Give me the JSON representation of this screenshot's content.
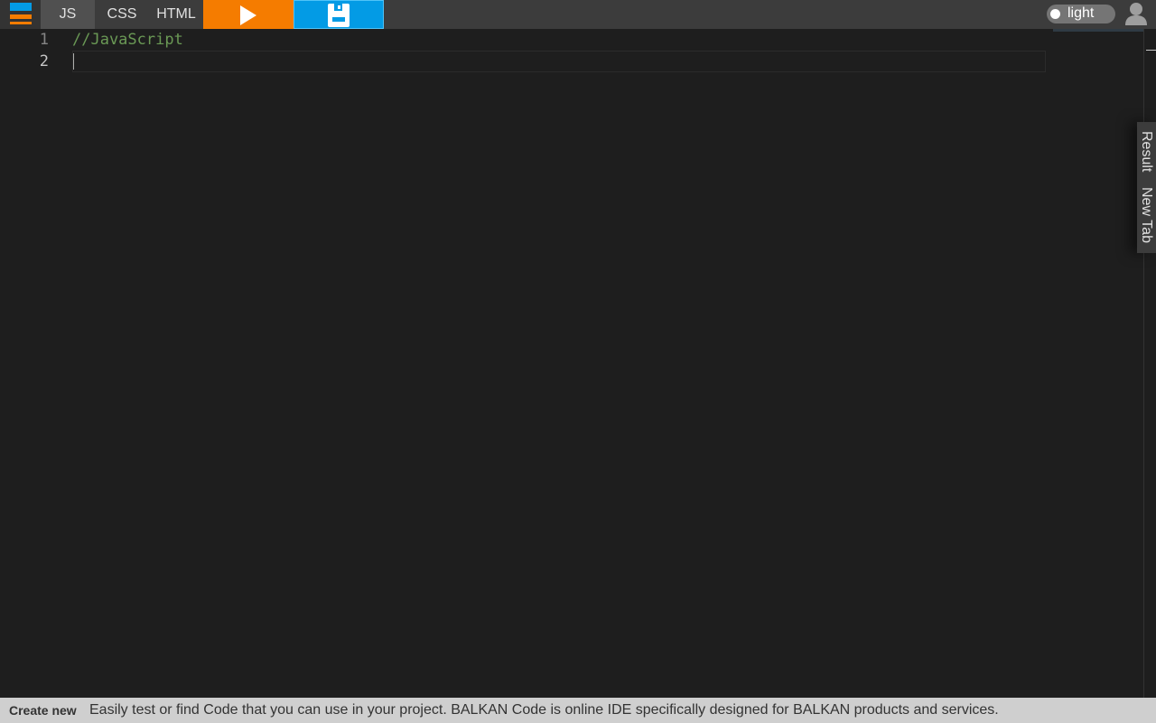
{
  "colors": {
    "topbar_bg": "#3c3c3c",
    "editor_bg": "#1e1e1e",
    "run_button": "#f57c00",
    "save_button": "#039be5",
    "comment": "#6a9955",
    "footer_bg": "#cfcfcf"
  },
  "toolbar": {
    "logo_icon": "balkan-logo-icon",
    "tabs": [
      {
        "label": "JS",
        "active": true
      },
      {
        "label": "CSS",
        "active": false
      },
      {
        "label": "HTML",
        "active": false
      }
    ],
    "run_icon": "play-icon",
    "save_icon": "save-icon",
    "theme_toggle_label": "light",
    "user_icon": "user-icon"
  },
  "editor": {
    "lines": [
      {
        "number": "1",
        "text": "//JavaScript"
      },
      {
        "number": "2",
        "text": ""
      }
    ]
  },
  "side_tabs": {
    "result": "Result",
    "new_tab": "New Tab"
  },
  "footer": {
    "create_new": "Create new",
    "description": "Easily test or find Code that you can use in your project. BALKAN Code is online IDE specifically designed for BALKAN products and services."
  }
}
